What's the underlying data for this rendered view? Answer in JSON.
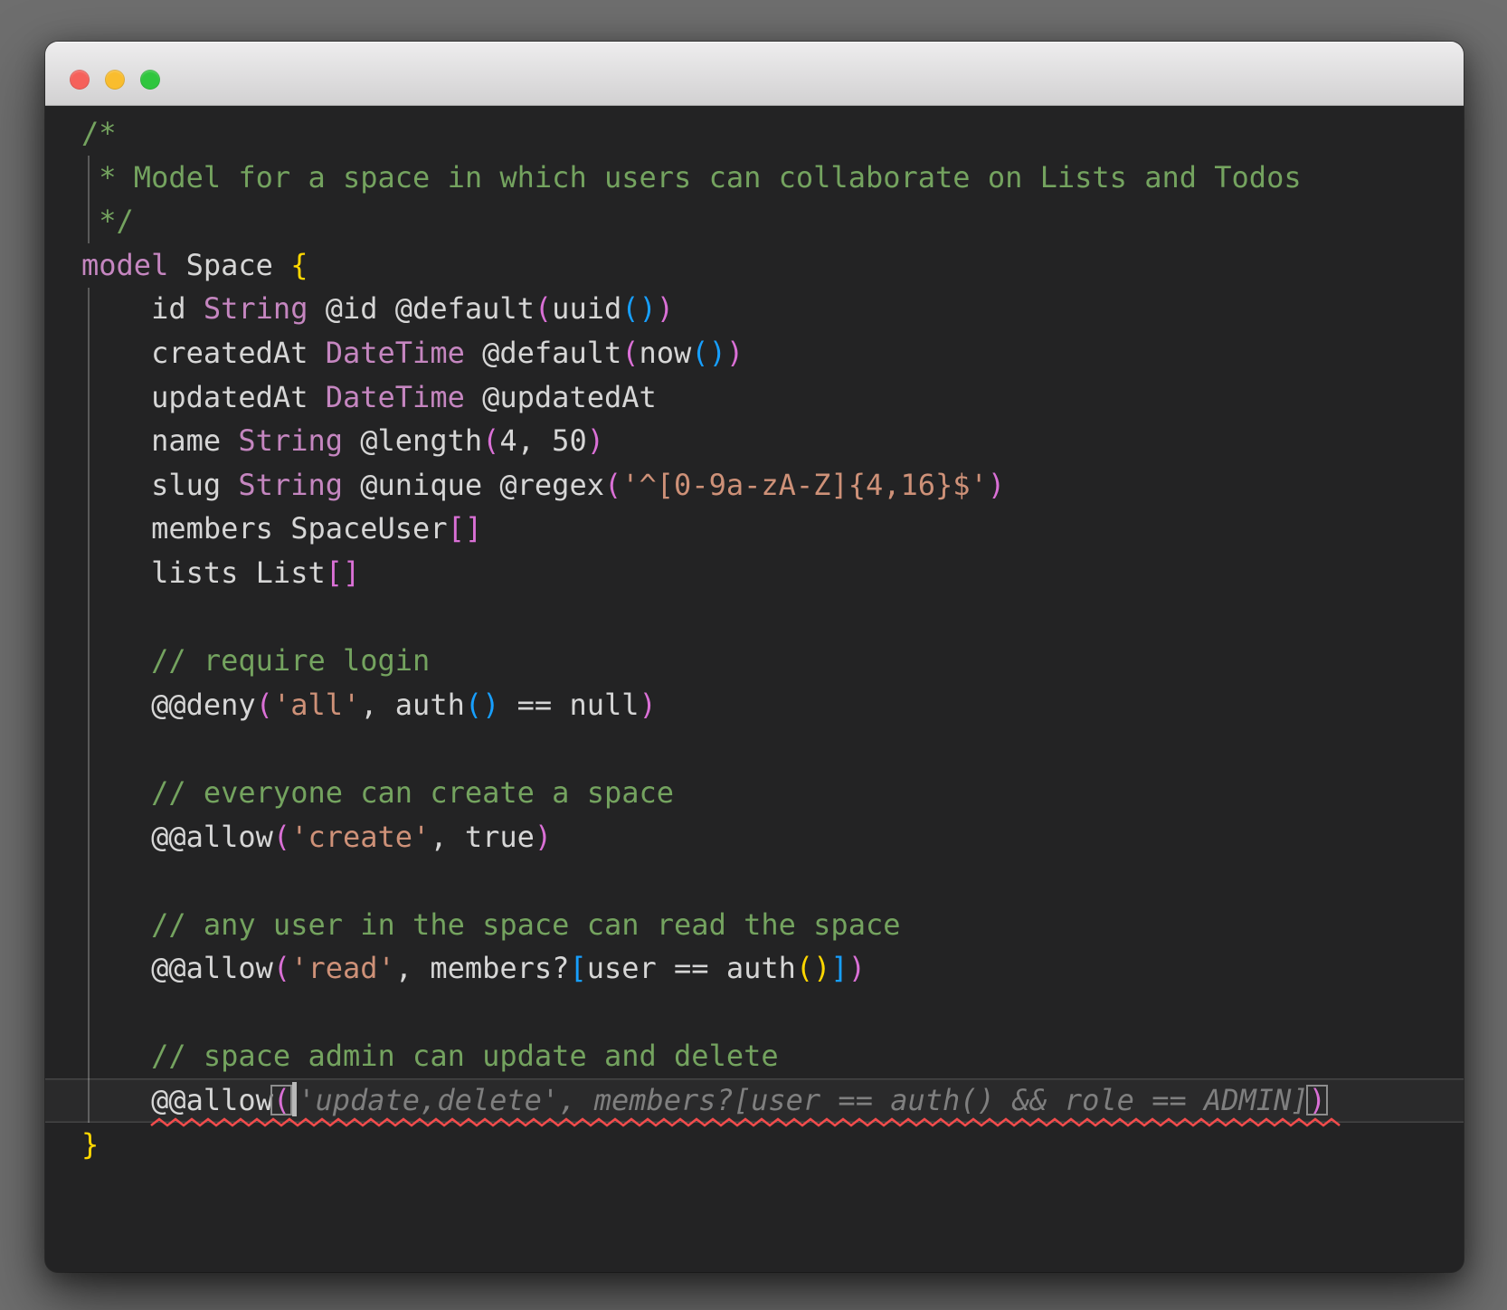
{
  "window": {
    "title": "",
    "traffic_lights": [
      {
        "name": "close",
        "color": "#f5615b"
      },
      {
        "name": "minimize",
        "color": "#f9bd2e"
      },
      {
        "name": "zoom",
        "color": "#2fc63e"
      }
    ]
  },
  "theme": {
    "colors": {
      "page-bg": "#6e6e6e",
      "titlebar-top": "#eeedee",
      "titlebar-bottom": "#d2d1d2",
      "editor-bg": "#232324",
      "fg": "#d6d6d6",
      "comment": "#74a35f",
      "keyword": "#c586c0",
      "string": "#ce9178",
      "bracket-1": "#ffd700",
      "bracket-2": "#da70d6",
      "bracket-3": "#179fff",
      "ghost": "#7f7f7f",
      "error": "#f14c4c",
      "guide": "#5a5a5a",
      "cursor": "#b8b8b8",
      "match-border": "#8d8d8d"
    }
  },
  "editor": {
    "lines": [
      {
        "tokens": [
          [
            "c",
            "/*"
          ]
        ]
      },
      {
        "tokens": [
          [
            "c",
            " * Model for a space in which users can collaborate on Lists and Todos"
          ]
        ]
      },
      {
        "tokens": [
          [
            "c",
            " */"
          ]
        ]
      },
      {
        "tokens": [
          [
            "k",
            "model"
          ],
          [
            "t",
            " Space "
          ],
          [
            "b1",
            "{"
          ]
        ]
      },
      {
        "tokens": [
          [
            "t",
            "    id "
          ],
          [
            "k",
            "String"
          ],
          [
            "t",
            " @id @default"
          ],
          [
            "b2",
            "("
          ],
          [
            "t",
            "uuid"
          ],
          [
            "b3",
            "()"
          ],
          [
            "b2",
            ")"
          ]
        ]
      },
      {
        "tokens": [
          [
            "t",
            "    createdAt "
          ],
          [
            "k",
            "DateTime"
          ],
          [
            "t",
            " @default"
          ],
          [
            "b2",
            "("
          ],
          [
            "t",
            "now"
          ],
          [
            "b3",
            "()"
          ],
          [
            "b2",
            ")"
          ]
        ]
      },
      {
        "tokens": [
          [
            "t",
            "    updatedAt "
          ],
          [
            "k",
            "DateTime"
          ],
          [
            "t",
            " @updatedAt"
          ]
        ]
      },
      {
        "tokens": [
          [
            "t",
            "    name "
          ],
          [
            "k",
            "String"
          ],
          [
            "t",
            " @length"
          ],
          [
            "b2",
            "("
          ],
          [
            "t",
            "4, 50"
          ],
          [
            "b2",
            ")"
          ]
        ]
      },
      {
        "tokens": [
          [
            "t",
            "    slug "
          ],
          [
            "k",
            "String"
          ],
          [
            "t",
            " @unique @regex"
          ],
          [
            "b2",
            "("
          ],
          [
            "s",
            "'^[0-9a-zA-Z]{4,16}$'"
          ],
          [
            "b2",
            ")"
          ]
        ]
      },
      {
        "tokens": [
          [
            "t",
            "    members SpaceUser"
          ],
          [
            "b2",
            "[]"
          ]
        ]
      },
      {
        "tokens": [
          [
            "t",
            "    lists List"
          ],
          [
            "b2",
            "[]"
          ]
        ]
      },
      {
        "tokens": []
      },
      {
        "tokens": [
          [
            "c",
            "    // require login"
          ]
        ]
      },
      {
        "tokens": [
          [
            "t",
            "    @@deny"
          ],
          [
            "b2",
            "("
          ],
          [
            "s",
            "'all'"
          ],
          [
            "t",
            ", auth"
          ],
          [
            "b3",
            "()"
          ],
          [
            "t",
            " == null"
          ],
          [
            "b2",
            ")"
          ]
        ]
      },
      {
        "tokens": []
      },
      {
        "tokens": [
          [
            "c",
            "    // everyone can create a space"
          ]
        ]
      },
      {
        "tokens": [
          [
            "t",
            "    @@allow"
          ],
          [
            "b2",
            "("
          ],
          [
            "s",
            "'create'"
          ],
          [
            "t",
            ", true"
          ],
          [
            "b2",
            ")"
          ]
        ]
      },
      {
        "tokens": []
      },
      {
        "tokens": [
          [
            "c",
            "    // any user in the space can read the space"
          ]
        ]
      },
      {
        "tokens": [
          [
            "t",
            "    @@allow"
          ],
          [
            "b2",
            "("
          ],
          [
            "s",
            "'read'"
          ],
          [
            "t",
            ", members?"
          ],
          [
            "b3",
            "["
          ],
          [
            "t",
            "user == auth"
          ],
          [
            "b1",
            "()"
          ],
          [
            "b3",
            "]"
          ],
          [
            "b2",
            ")"
          ]
        ]
      },
      {
        "tokens": []
      },
      {
        "tokens": [
          [
            "c",
            "    // space admin can update and delete"
          ]
        ]
      },
      {
        "error": true,
        "current": true,
        "tokens": [
          [
            "t",
            "    "
          ],
          [
            "t",
            "@@allow"
          ],
          [
            "b2 match",
            "("
          ],
          [
            "cur",
            ""
          ],
          [
            "g",
            "'update,delete', members?[user == auth() && role == ADMIN]"
          ],
          [
            "b2 match",
            ")"
          ]
        ]
      },
      {
        "tokens": [
          [
            "b1",
            "}"
          ]
        ]
      }
    ]
  }
}
